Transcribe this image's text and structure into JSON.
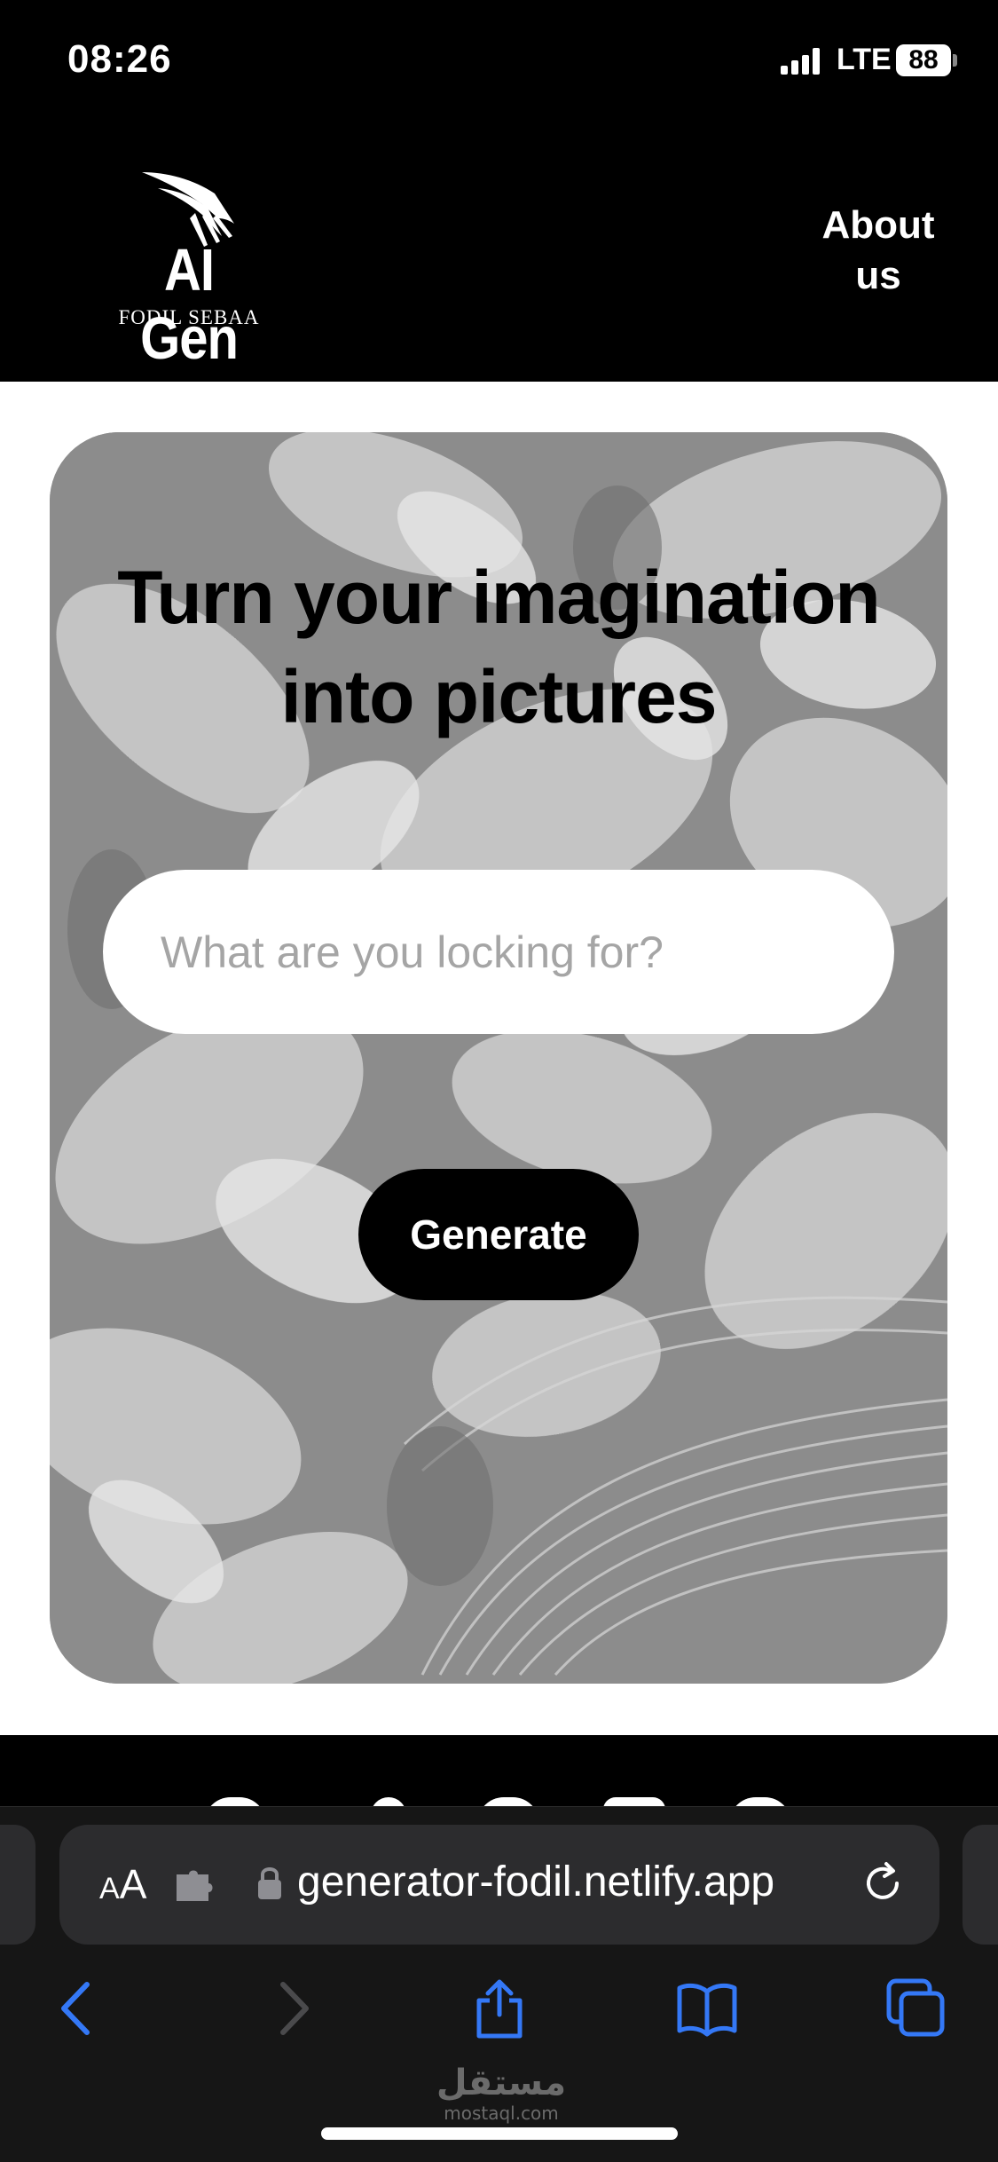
{
  "status_bar": {
    "time": "08:26",
    "network": "LTE",
    "battery": "88"
  },
  "header": {
    "logo_title": "AI Gen",
    "logo_subtitle": "FODIL SEBAA",
    "about_link": "About us"
  },
  "hero": {
    "title": "Turn your imagination into pictures",
    "search_placeholder": "What are you locking for?",
    "generate_button": "Generate"
  },
  "browser": {
    "text_size_label": "AA",
    "url": "generator-fodil.netlify.app",
    "watermark_arabic": "مستقل",
    "watermark_latin": "mostaql.com"
  },
  "icons": {
    "logo": "wing-logo-icon",
    "signal": "cellular-signal-icon",
    "lock": "lock-icon",
    "extension": "puzzle-extension-icon",
    "reload": "reload-icon",
    "back": "back-chevron-icon",
    "forward": "forward-chevron-icon",
    "share": "share-icon",
    "bookmarks": "bookmarks-icon",
    "tabs": "tabs-icon"
  },
  "colors": {
    "accent": "#3478f6",
    "header_bg": "#000000",
    "hero_bg": "#8a8a8a"
  }
}
